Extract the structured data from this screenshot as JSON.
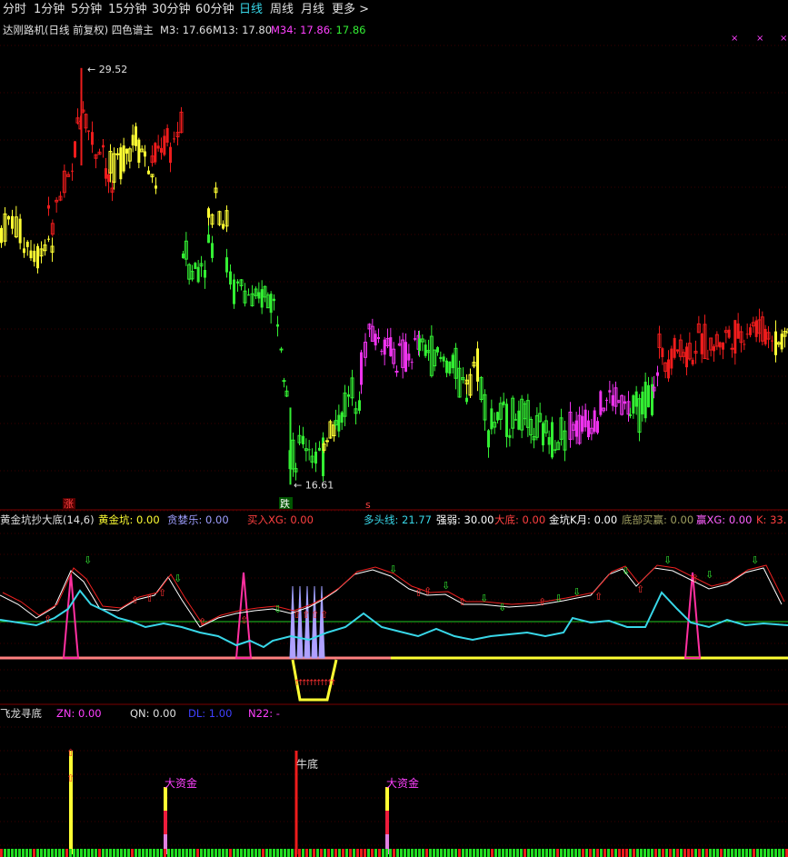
{
  "tabs": [
    {
      "label": "分时"
    },
    {
      "label": "1分钟"
    },
    {
      "label": "5分钟"
    },
    {
      "label": "15分钟"
    },
    {
      "label": "30分钟"
    },
    {
      "label": "60分钟"
    },
    {
      "label": "日线",
      "active": true
    },
    {
      "label": "周线"
    },
    {
      "label": "月线"
    },
    {
      "label": "更多 >"
    }
  ],
  "main": {
    "title": "达刚路机(日线 前复权) 四色谱主",
    "m3": "M3: 17.66",
    "m13": "M13: 17.80",
    "m34": "M34: 17.86",
    "m34b": ": 17.86",
    "high_label": "29.52",
    "low_label": "16.61",
    "signal_zhang": "涨",
    "signal_die": "跌",
    "signal_s": "s"
  },
  "indicator1": {
    "name": "黄金坑抄大底(14,6)",
    "items": [
      {
        "label": "黄金坑: 0.00",
        "color": "#ffff33"
      },
      {
        "label": "贪婪乐: 0.00",
        "color": "#9f9fff"
      },
      {
        "label": "买入XG: 0.00",
        "color": "#ff4040"
      },
      {
        "label": "多头线: 21.77",
        "color": "#38d7e8"
      },
      {
        "label": "强弱: 30.00",
        "color": "#ffffff"
      },
      {
        "label": "大底: 0.00",
        "color": "#ff4040"
      },
      {
        "label": "金坑K月: 0.00",
        "color": "#ffffff"
      },
      {
        "label": "底部买赢: 0.00",
        "color": "#a0a060"
      },
      {
        "label": "赢XG: 0.00",
        "color": "#ff60ff"
      },
      {
        "label": "K: 33.",
        "color": "#ff4040"
      }
    ]
  },
  "indicator2": {
    "name": "飞龙寻底",
    "items": [
      {
        "label": "ZN: 0.00",
        "color": "#ff40ff"
      },
      {
        "label": "QN: 0.00",
        "color": "#e0e0e0"
      },
      {
        "label": "DL: 1.00",
        "color": "#4040ff"
      },
      {
        "label": "N22: -",
        "color": "#ff40ff"
      }
    ],
    "labels": {
      "dazijin": "大资金",
      "niudi": "牛底"
    }
  },
  "colors": {
    "red": "#ee1c1c",
    "yellow": "#ffff33",
    "green": "#33ee33",
    "magenta": "#ee33ee"
  },
  "chart_data": {
    "type": "candlestick",
    "price_ylim": [
      16.0,
      30.5
    ],
    "highest": 29.52,
    "lowest": 16.61,
    "segments": [
      {
        "color": "yellow",
        "points": [
          [
            0,
            24.5
          ],
          [
            12,
            24.8
          ],
          [
            25,
            24.2
          ],
          [
            40,
            23.8
          ],
          [
            52,
            24.3
          ]
        ]
      },
      {
        "color": "red",
        "points": [
          [
            52,
            24.6
          ],
          [
            65,
            25.5
          ],
          [
            78,
            26.2
          ],
          [
            84,
            27.8
          ],
          [
            90,
            28.4
          ],
          [
            96,
            27.6
          ],
          [
            104,
            27.0
          ],
          [
            112,
            27.2
          ],
          [
            118,
            25.8
          ]
        ]
      },
      {
        "color": "yellow",
        "points": [
          [
            120,
            26.2
          ],
          [
            128,
            26.6
          ],
          [
            138,
            27.0
          ],
          [
            148,
            27.4
          ],
          [
            158,
            26.8
          ],
          [
            166,
            26.0
          ]
        ]
      },
      {
        "color": "red",
        "points": [
          [
            166,
            26.5
          ],
          [
            176,
            27.2
          ],
          [
            186,
            27.0
          ],
          [
            194,
            27.6
          ]
        ]
      },
      {
        "color": "green",
        "points": [
          [
            200,
            24.0
          ],
          [
            210,
            23.2
          ],
          [
            220,
            23.5
          ],
          [
            228,
            24.0
          ]
        ]
      },
      {
        "color": "yellow",
        "points": [
          [
            228,
            24.8
          ],
          [
            236,
            25.8
          ],
          [
            244,
            24.8
          ]
        ]
      },
      {
        "color": "green",
        "points": [
          [
            248,
            23.4
          ],
          [
            256,
            22.6
          ],
          [
            264,
            22.8
          ],
          [
            272,
            22.5
          ],
          [
            280,
            22.0
          ],
          [
            290,
            22.6
          ],
          [
            300,
            22.2
          ],
          [
            308,
            21.4
          ],
          [
            314,
            19.8
          ],
          [
            318,
            17.6
          ],
          [
            324,
            17.2
          ],
          [
            332,
            18.0
          ],
          [
            342,
            17.7
          ],
          [
            350,
            17.4
          ]
        ]
      },
      {
        "color": "yellow",
        "points": [
          [
            355,
            18.0
          ],
          [
            362,
            18.4
          ]
        ]
      },
      {
        "color": "green",
        "points": [
          [
            368,
            18.4
          ],
          [
            378,
            19.1
          ],
          [
            390,
            19.6
          ]
        ]
      },
      {
        "color": "magenta",
        "points": [
          [
            396,
            20.2
          ],
          [
            405,
            21.4
          ],
          [
            415,
            21.1
          ],
          [
            425,
            21.0
          ],
          [
            435,
            20.6
          ],
          [
            445,
            20.5
          ],
          [
            455,
            20.8
          ]
        ]
      },
      {
        "color": "green",
        "points": [
          [
            460,
            20.9
          ],
          [
            470,
            20.8
          ],
          [
            480,
            20.5
          ],
          [
            490,
            20.4
          ],
          [
            500,
            20.2
          ],
          [
            508,
            19.6
          ]
        ]
      },
      {
        "color": "yellow",
        "points": [
          [
            512,
            20.0
          ],
          [
            520,
            20.3
          ]
        ]
      },
      {
        "color": "green",
        "points": [
          [
            528,
            19.8
          ],
          [
            536,
            18.4
          ],
          [
            546,
            18.7
          ],
          [
            556,
            18.6
          ],
          [
            566,
            18.8
          ],
          [
            576,
            18.6
          ],
          [
            586,
            18.3
          ],
          [
            596,
            18.2
          ],
          [
            606,
            18.1
          ],
          [
            616,
            18.3
          ]
        ]
      },
      {
        "color": "magenta",
        "points": [
          [
            626,
            18.5
          ],
          [
            636,
            18.4
          ],
          [
            646,
            18.6
          ],
          [
            656,
            18.9
          ],
          [
            666,
            19.2
          ],
          [
            676,
            19.3
          ],
          [
            686,
            19.0
          ]
        ]
      },
      {
        "color": "green",
        "points": [
          [
            692,
            18.8
          ],
          [
            702,
            18.9
          ],
          [
            712,
            19.4
          ]
        ]
      },
      {
        "color": "magenta",
        "points": [
          [
            718,
            19.8
          ]
        ]
      },
      {
        "color": "red",
        "points": [
          [
            724,
            20.8
          ],
          [
            734,
            20.6
          ],
          [
            744,
            20.9
          ],
          [
            754,
            20.7
          ],
          [
            764,
            20.9
          ],
          [
            774,
            21.0
          ],
          [
            784,
            20.9
          ],
          [
            794,
            21.1
          ],
          [
            804,
            21.3
          ],
          [
            814,
            21.2
          ],
          [
            824,
            21.6
          ],
          [
            834,
            21.4
          ],
          [
            844,
            21.3
          ]
        ]
      },
      {
        "color": "yellow",
        "points": [
          [
            852,
            21.0
          ],
          [
            862,
            21.3
          ]
        ]
      }
    ]
  }
}
